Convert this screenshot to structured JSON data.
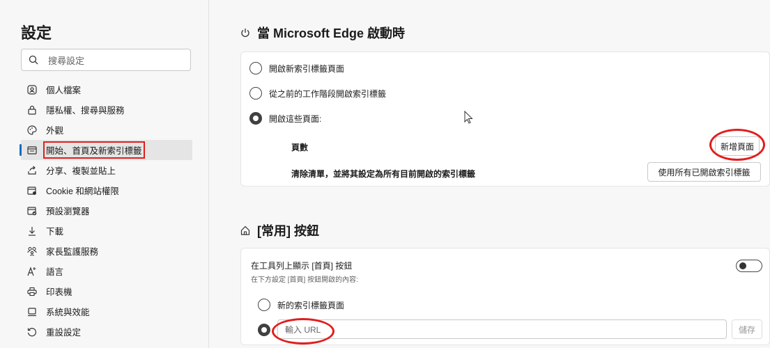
{
  "sidebar": {
    "title": "設定",
    "search_placeholder": "搜尋設定",
    "items": [
      {
        "label": "個人檔案",
        "icon": "profile-icon"
      },
      {
        "label": "隱私權、搜尋與服務",
        "icon": "lock-icon"
      },
      {
        "label": "外觀",
        "icon": "palette-icon"
      },
      {
        "label": "開始、首頁及新索引標籤",
        "icon": "start-page-icon",
        "active": true
      },
      {
        "label": "分享、複製並貼上",
        "icon": "share-icon"
      },
      {
        "label": "Cookie 和網站權限",
        "icon": "site-permissions-icon"
      },
      {
        "label": "預設瀏覽器",
        "icon": "default-browser-icon"
      },
      {
        "label": "下載",
        "icon": "download-icon"
      },
      {
        "label": "家長監護服務",
        "icon": "family-icon"
      },
      {
        "label": "語言",
        "icon": "language-icon"
      },
      {
        "label": "印表機",
        "icon": "printer-icon"
      },
      {
        "label": "系統與效能",
        "icon": "system-icon"
      },
      {
        "label": "重設設定",
        "icon": "reset-icon"
      }
    ]
  },
  "startup": {
    "heading": "當 Microsoft Edge 啟動時",
    "options": [
      "開啟新索引標籤頁面",
      "從之前的工作階段開啟索引標籤",
      "開啟這些頁面:"
    ],
    "selected_index": 2,
    "pages_label": "頁數",
    "add_page_button": "新增頁面",
    "clear_list_text": "清除清單，並將其設定為所有目前開啟的索引標籤",
    "use_all_tabs_button": "使用所有已開啟索引標籤"
  },
  "home_button": {
    "heading": "[常用] 按鈕",
    "show_label": "在工具列上顯示 [首頁] 按鈕",
    "show_desc": "在下方設定 [首頁] 按鈕開啟的內容:",
    "toggle_on": false,
    "options": [
      "新的索引標籤頁面"
    ],
    "url_placeholder": "輸入 URL",
    "save_button": "儲存"
  },
  "annotation_color": "#e21d1d",
  "accent_color": "#0f6cbd"
}
